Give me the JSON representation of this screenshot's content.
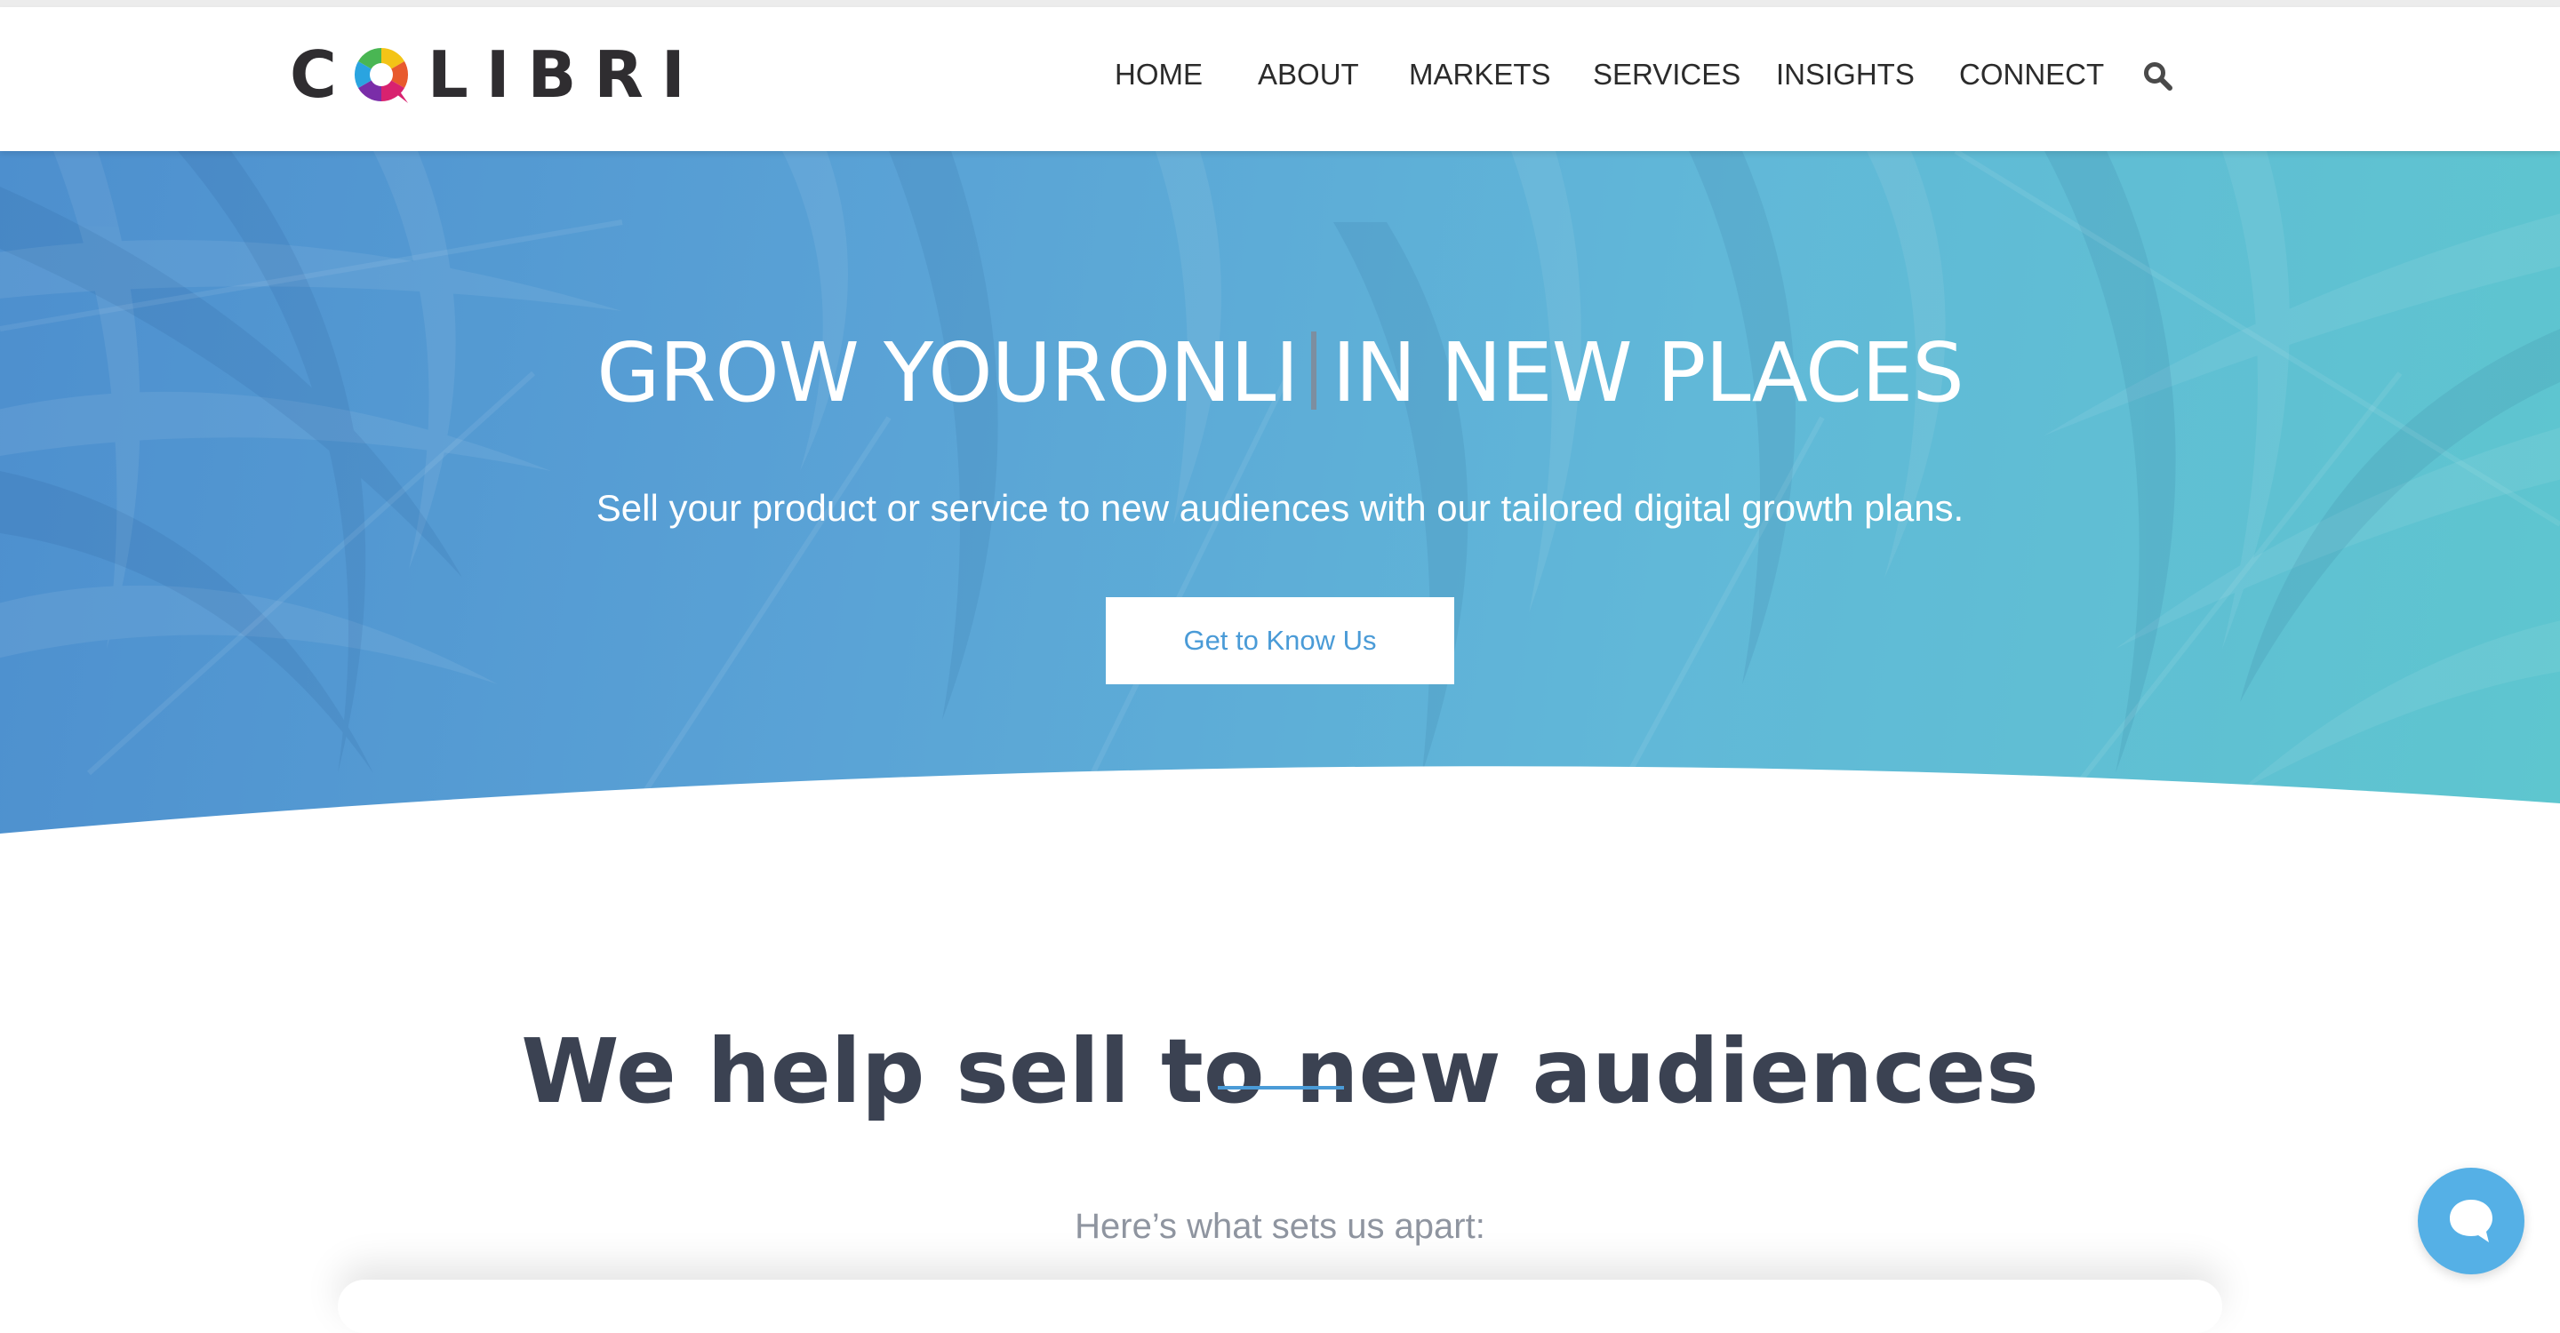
{
  "brand": {
    "logo_text_pre": "C",
    "logo_text_post": "LIBRI"
  },
  "nav": {
    "items": [
      {
        "label": "HOME"
      },
      {
        "label": "ABOUT"
      },
      {
        "label": "MARKETS"
      },
      {
        "label": "SERVICES"
      },
      {
        "label": "INSIGHTS"
      },
      {
        "label": "CONNECT"
      }
    ],
    "search_icon": "search-icon"
  },
  "hero": {
    "title_typed": "GROW YOURONLI",
    "title_static": "IN NEW PLACES",
    "subtitle": "Sell your product or service to new audiences with our tailored digital growth plans.",
    "cta_label": "Get to Know Us"
  },
  "section": {
    "title": "We help sell to new audiences",
    "subtitle": "Here’s what sets us apart:"
  },
  "chat": {
    "icon": "chat-bubble-icon"
  },
  "colors": {
    "accent": "#4a9bd7",
    "hero_blue": "#4d8fce",
    "hero_teal": "#5ec6cf",
    "heading": "#3b4252",
    "muted": "#8f95a0",
    "chat": "#55b0e6"
  }
}
